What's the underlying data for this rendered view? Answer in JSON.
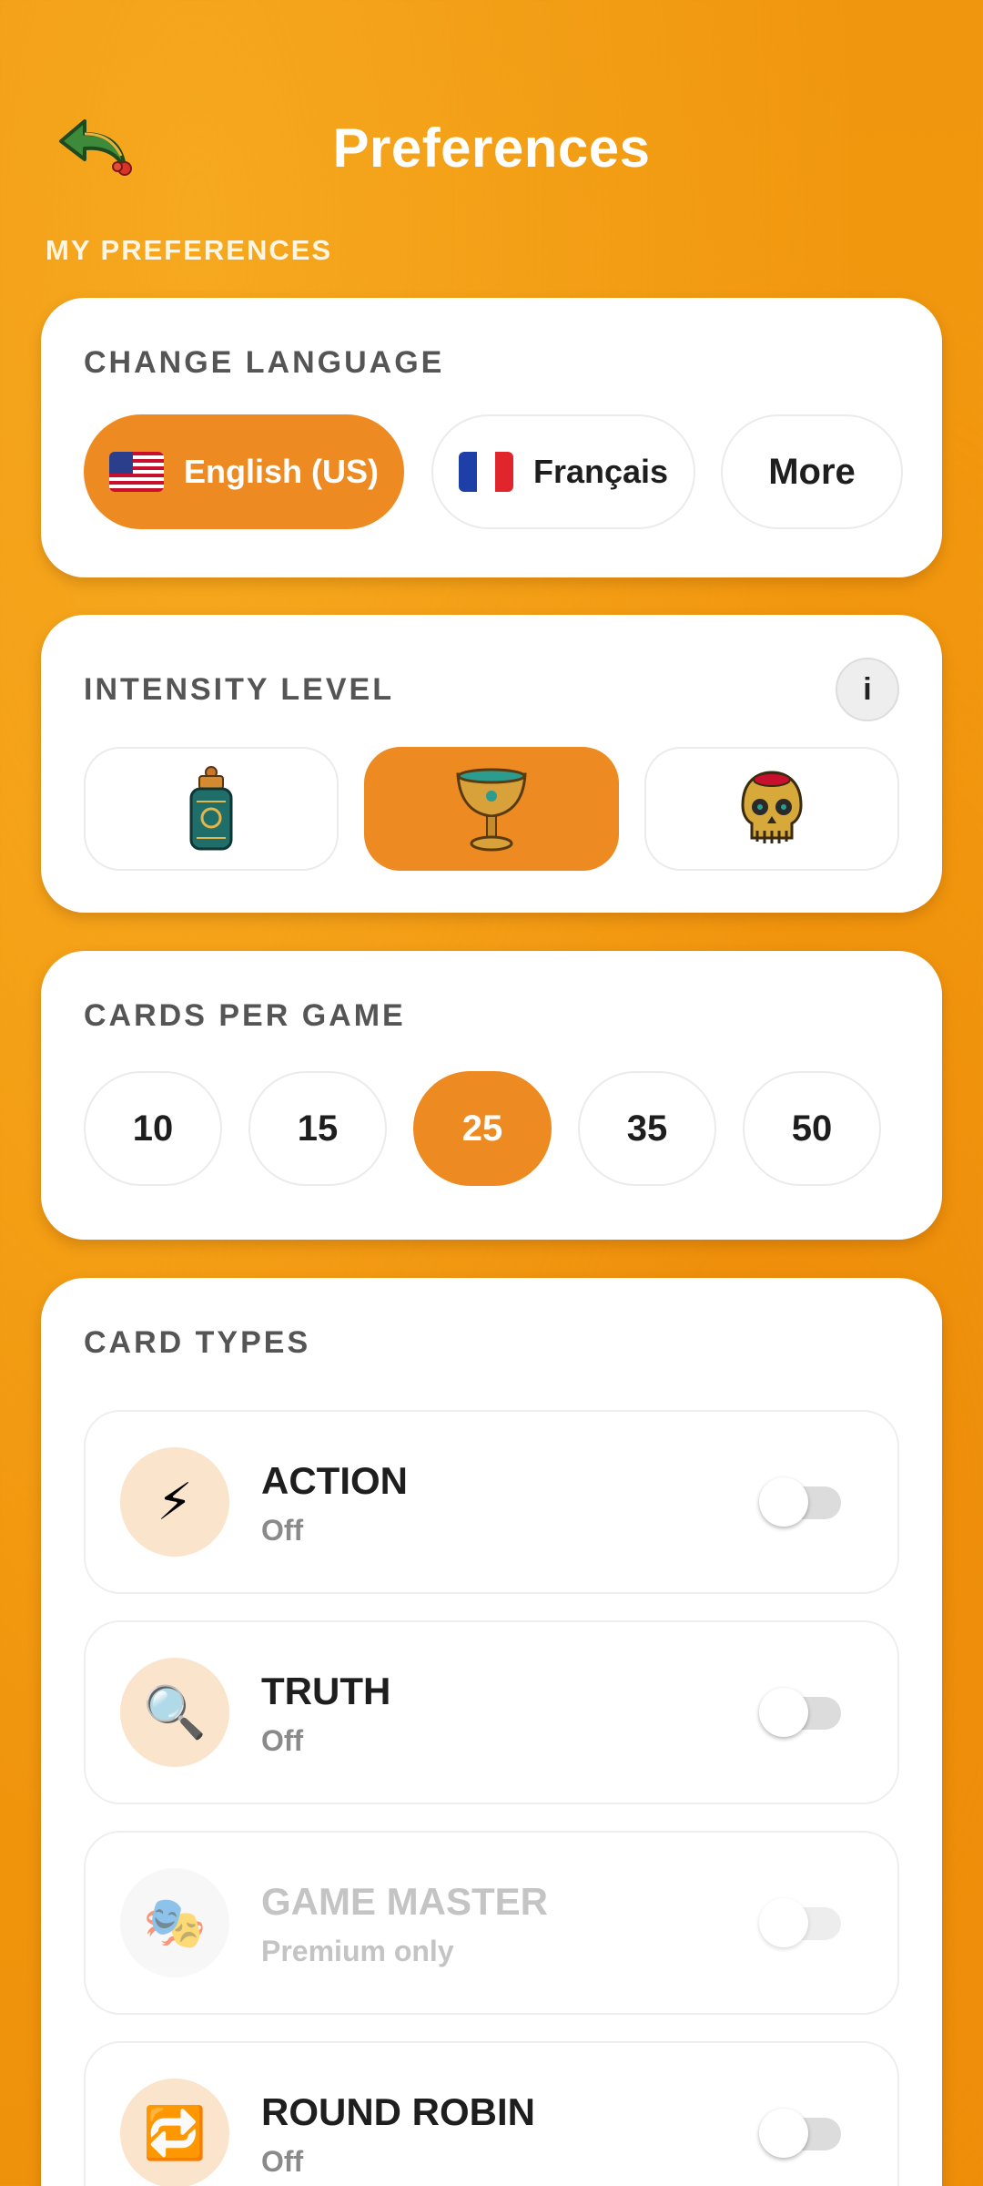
{
  "header": {
    "title": "Preferences",
    "back_icon": "back-arrow-icon"
  },
  "section_label": "MY PREFERENCES",
  "language": {
    "title": "CHANGE LANGUAGE",
    "options": [
      {
        "label": "English (US)",
        "flag": "us-flag-icon",
        "selected": true
      },
      {
        "label": "Français",
        "flag": "fr-flag-icon",
        "selected": false
      },
      {
        "label": "More",
        "selected": false
      }
    ]
  },
  "intensity": {
    "title": "INTENSITY LEVEL",
    "info_label": "i",
    "options": [
      {
        "icon": "baby-bottle-icon",
        "selected": false
      },
      {
        "icon": "chalice-icon",
        "selected": true
      },
      {
        "icon": "skull-icon",
        "selected": false
      }
    ]
  },
  "cards_per_game": {
    "title": "CARDS PER GAME",
    "options": [
      "10",
      "15",
      "25",
      "35",
      "50"
    ],
    "selected": "25"
  },
  "card_types": {
    "title": "CARD TYPES",
    "items": [
      {
        "name": "ACTION",
        "status": "Off",
        "icon": "lightning-icon",
        "glyph": "⚡",
        "enabled": true,
        "on": false
      },
      {
        "name": "TRUTH",
        "status": "Off",
        "icon": "magnifier-icon",
        "glyph": "🔍",
        "enabled": true,
        "on": false
      },
      {
        "name": "GAME MASTER",
        "status": "Premium only",
        "icon": "game-master-icon",
        "glyph": "🎭",
        "enabled": false,
        "on": false
      },
      {
        "name": "ROUND ROBIN",
        "status": "Off",
        "icon": "repeat-icon",
        "glyph": "🔁",
        "enabled": true,
        "on": false
      }
    ]
  },
  "colors": {
    "accent": "#ed8b22",
    "background": "#f39a10"
  }
}
